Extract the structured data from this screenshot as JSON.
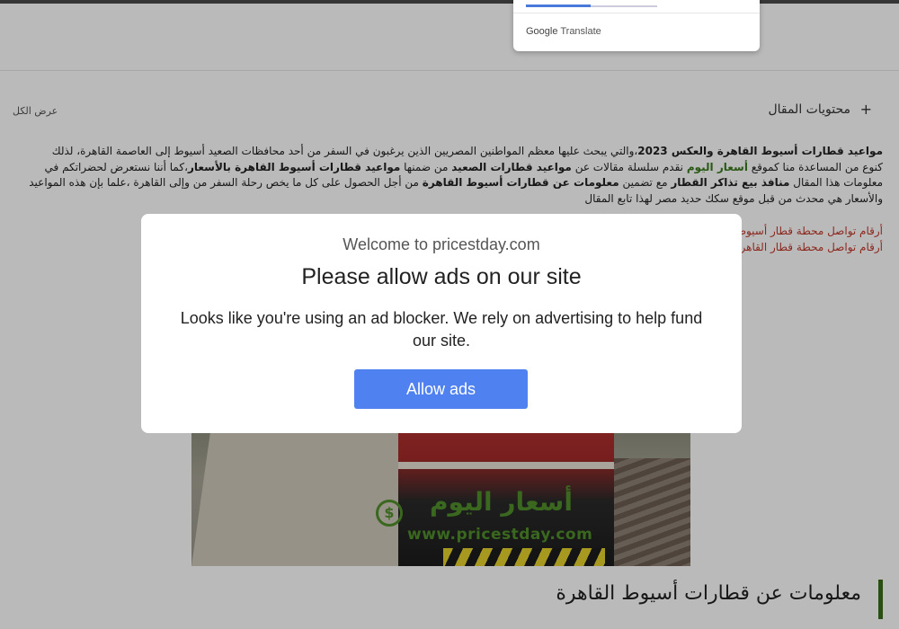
{
  "translate": {
    "brand": "Google",
    "label": "Translate"
  },
  "toc": {
    "title": "محتويات المقال",
    "plus": "+",
    "view_all": "عرض الكل"
  },
  "article": {
    "l1_bold": "مواعيد قطارات أسيوط القاهرة والعكس 2023",
    "l1_rest": "،والتي يبحث عليها معظم المواطنين المصريين الذين يرغبون في السفر من أحد محافظات الصعيد أسيوط إلى العاصمة القاهرة، لذلك",
    "l2_a": "كنوع من المساعدة منا كموقع ",
    "l2_green": "أسعار اليوم",
    "l2_b": " نقدم سلسلة مقالات عن ",
    "l2_bold1": "مواعيد قطارات الصعيد",
    "l2_c": " من ضمنها ",
    "l2_bold2": "مواعيد قطارات أسيوط القاهرة بالأسعار",
    "l2_d": "،كما أننا نستعرض لحضراتكم في",
    "l3_a": "معلومات هذا المقال ",
    "l3_bold1": "منافذ بيع تذاكر القطار",
    "l3_b": " مع تضمين ",
    "l3_bold2": "معلومات عن قطارات أسيوط القاهرة",
    "l3_c": " من أجل الحصول على كل ما يخص رحلة السفر من وإلى القاهرة ،علما بإن هذه المواعيد",
    "l4": "والأسعار هي محدث من قبل موقع سكك حديد مصر لهذا تابع المقال"
  },
  "links": [
    "أرقام تواصل محطة قطار أسيوط",
    "أرقام تواصل محطة قطار القاهرة"
  ],
  "hero": {
    "watermark_url": "www.pricestday.com",
    "watermark_ar": "أسعار اليوم",
    "watermark_symbol": "$"
  },
  "section": {
    "heading": "معلومات عن قطارات أسيوط القاهرة"
  },
  "modal": {
    "welcome": "Welcome to pricestday.com",
    "headline": "Please allow ads on our site",
    "body": "Looks like you're using an ad blocker. We rely on advertising to help fund our site.",
    "button": "Allow ads"
  },
  "colors": {
    "accent_green": "#3b6b1d",
    "link_red": "#c0392b",
    "button_blue": "#4f82f0"
  }
}
